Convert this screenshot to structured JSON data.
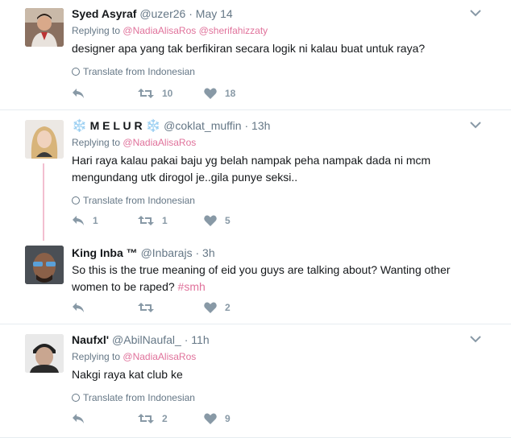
{
  "tweets": [
    {
      "name": "Syed Asyraf",
      "handle": "@uzer26",
      "dot": "·",
      "time": "May 14",
      "replying_label": "Replying to",
      "replying_to": "@NadiaAlisaRos @sherifahizzaty",
      "text": "designer apa yang tak berfikiran secara logik ni kalau buat untuk raya?",
      "translate": "Translate from Indonesian",
      "replies": "",
      "retweets": "10",
      "likes": "18"
    },
    {
      "name_prefix": "❄️",
      "name": "M E L U R",
      "name_suffix": "❄️",
      "handle": "@coklat_muffin",
      "dot": "·",
      "time": "13h",
      "replying_label": "Replying to",
      "replying_to": "@NadiaAlisaRos",
      "text": "Hari raya kalau pakai baju yg belah nampak peha nampak dada ni mcm mengundang utk dirogol je..gila punye seksi..",
      "translate": "Translate from Indonesian",
      "replies": "1",
      "retweets": "1",
      "likes": "5"
    },
    {
      "name": "King Inba ™",
      "handle": "@Inbarajs",
      "dot": "·",
      "time": "3h",
      "text": "So this is the true meaning of eid you guys are talking about? Wanting other women to be raped?",
      "hashtag": "#smh",
      "replies": "",
      "retweets": "",
      "likes": "2"
    },
    {
      "name": "Naufxl'",
      "handle": "@AbilNaufal_",
      "dot": "·",
      "time": "11h",
      "replying_label": "Replying to",
      "replying_to": "@NadiaAlisaRos",
      "text": "Nakgi raya kat club ke",
      "translate": "Translate from Indonesian",
      "replies": "",
      "retweets": "2",
      "likes": "9"
    }
  ],
  "colors": {
    "link": "#e0729b",
    "muted": "#657786",
    "icon": "#8899a6",
    "thread": "#f2bfd0"
  }
}
